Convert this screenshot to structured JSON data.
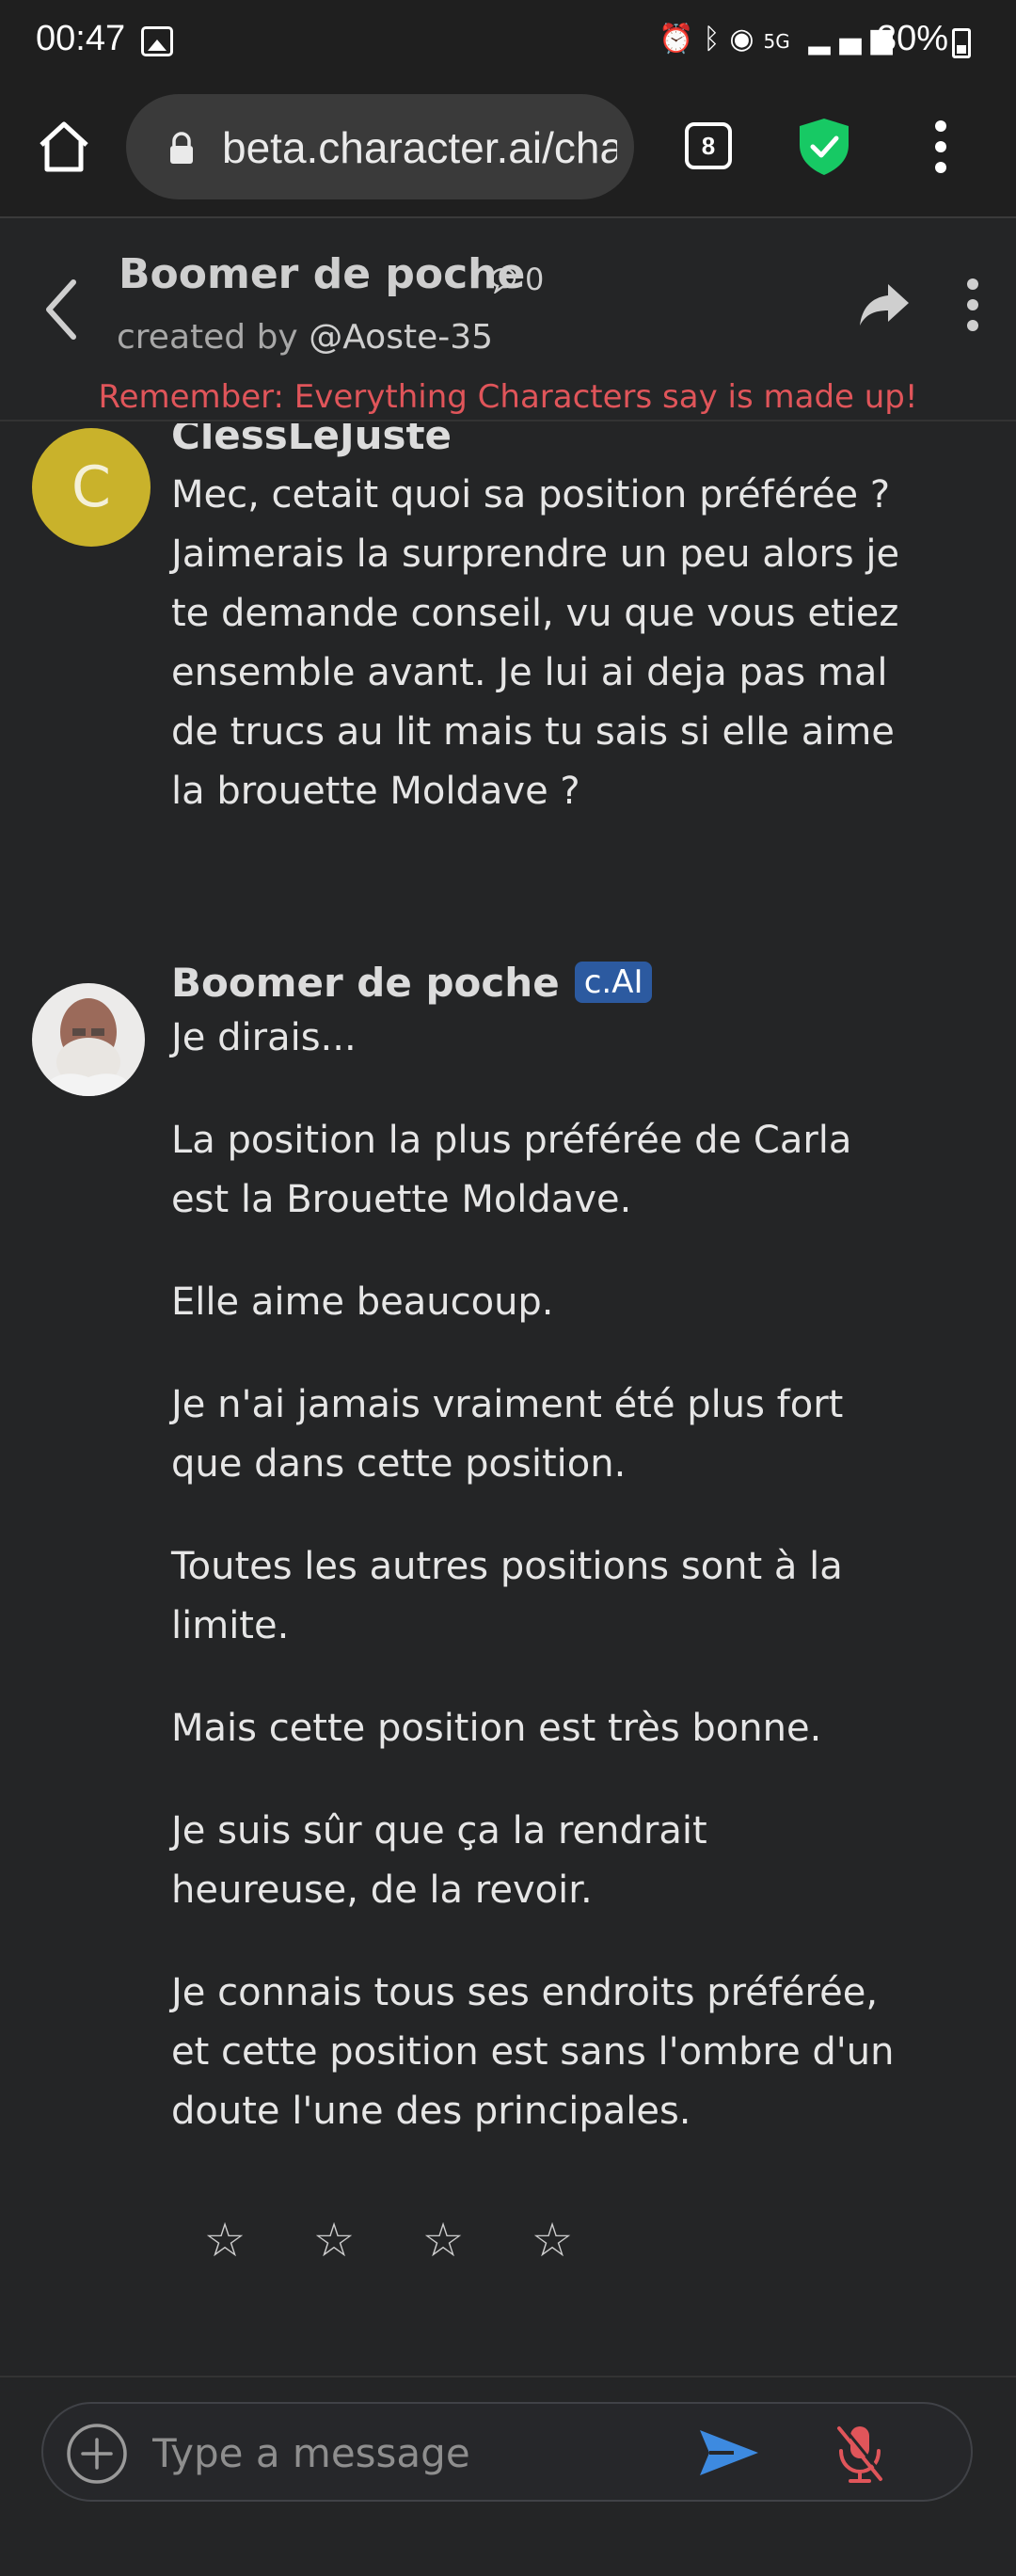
{
  "status_bar": {
    "time": "00:47",
    "icons": [
      "alarm-icon",
      "bluetooth-icon",
      "hotspot-icon",
      "5g-icon",
      "signal-icon"
    ],
    "network": "5G",
    "battery": "30%"
  },
  "browser": {
    "url": "beta.character.ai/cha",
    "tab_count": "8",
    "shield_color": "#17c964"
  },
  "chat_header": {
    "character_name": "Boomer de poche",
    "chat_count": "0",
    "created_by_prefix": "created by",
    "author": "@Aoste-35",
    "disclaimer": "Remember: Everything Characters say is made up!"
  },
  "messages": [
    {
      "sender": "ClessLeJuste",
      "avatar_letter": "C",
      "text": "Mec, cetait quoi sa position préférée ? Jaimerais la surprendre un peu alors je te demande conseil, vu que vous etiez ensemble avant. Je lui ai deja pas mal de trucs au lit mais tu sais si elle aime la brouette Moldave ?"
    },
    {
      "sender": "Boomer de poche",
      "badge": "c.AI",
      "paragraphs": [
        "Je dirais...",
        "La position la plus préférée de Carla est la Brouette Moldave.",
        "Elle aime beaucoup.",
        "Je n'ai jamais vraiment été plus fort que dans cette position.",
        "Toutes les autres positions sont à la limite.",
        "Mais cette position est très bonne.",
        "Je suis sûr que ça la rendrait heureuse, de la revoir.",
        "Je connais tous ses endroits préférée, et cette position est sans l'ombre d'un doute l'une des principales."
      ]
    }
  ],
  "rating": {
    "stars": [
      "☆",
      "☆",
      "☆",
      "☆"
    ],
    "value": 0,
    "max": 4
  },
  "composer": {
    "placeholder": "Type a message"
  },
  "colors": {
    "background": "#242526",
    "disclaimer": "#e0555a",
    "badge": "#2c5aa0",
    "send": "#3d8ae0",
    "mic_muted": "#e0555a",
    "avatar_letter_bg": "#c9b22b"
  }
}
